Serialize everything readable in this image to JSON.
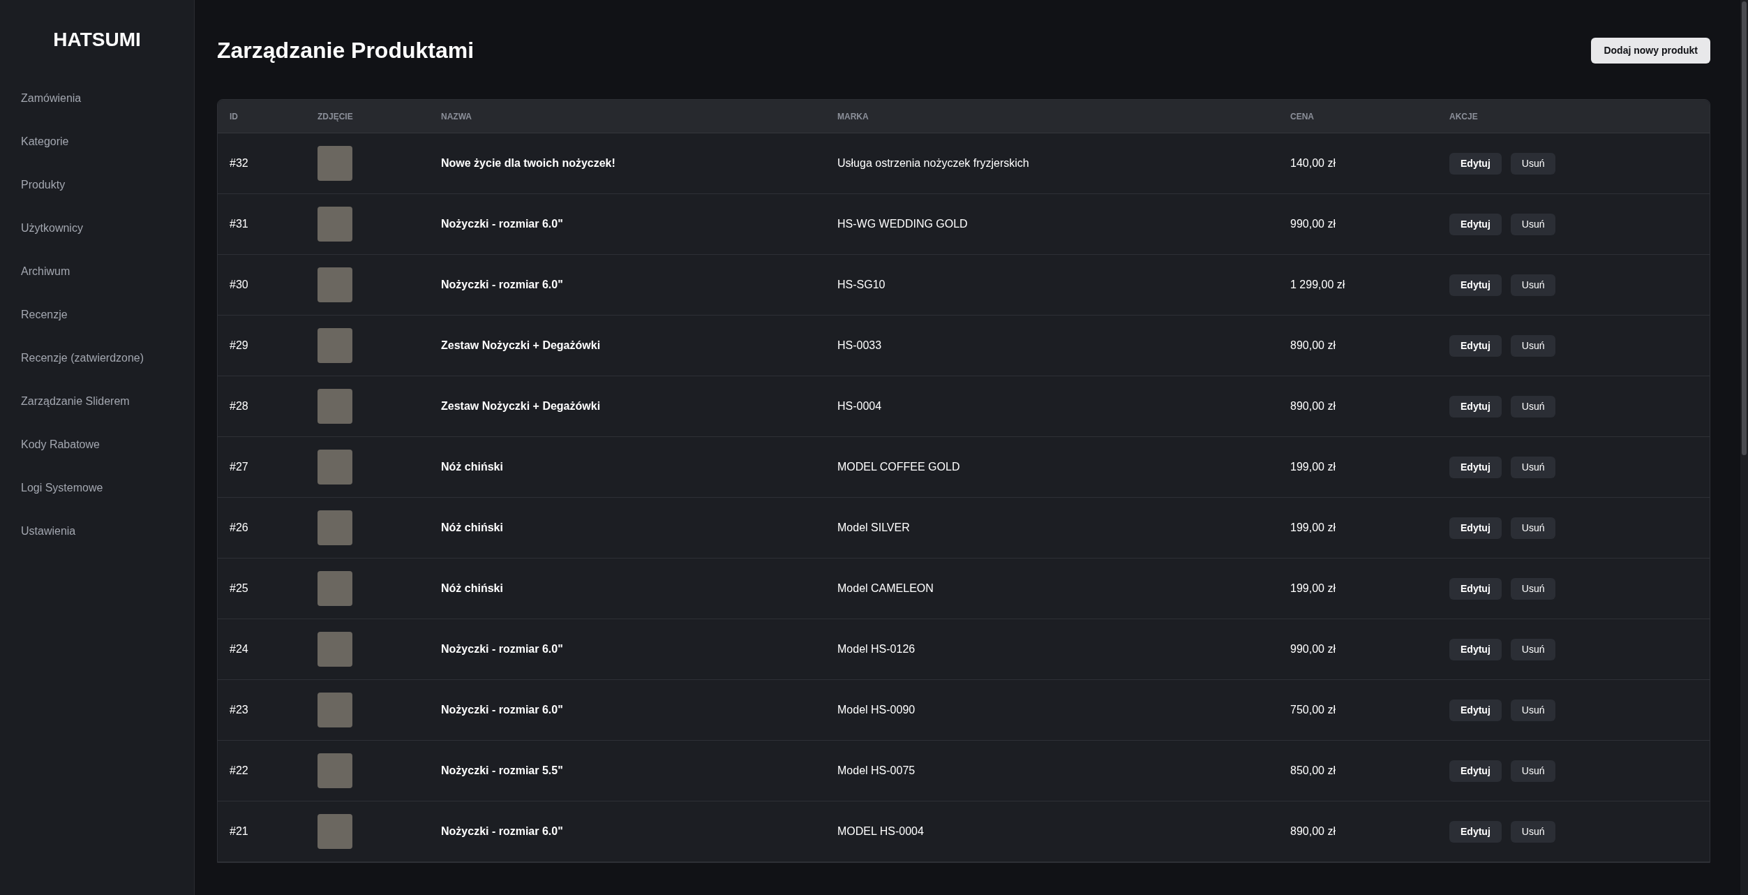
{
  "sidebar": {
    "logo": "HATSUMI",
    "items": [
      {
        "label": "Zamówienia"
      },
      {
        "label": "Kategorie"
      },
      {
        "label": "Produkty"
      },
      {
        "label": "Użytkownicy"
      },
      {
        "label": "Archiwum"
      },
      {
        "label": "Recenzje"
      },
      {
        "label": "Recenzje (zatwierdzone)"
      },
      {
        "label": "Zarządzanie Sliderem"
      },
      {
        "label": "Kody Rabatowe"
      },
      {
        "label": "Logi Systemowe"
      },
      {
        "label": "Ustawienia"
      }
    ]
  },
  "header": {
    "title": "Zarządzanie Produktami",
    "add_button": "Dodaj nowy produkt"
  },
  "table": {
    "columns": [
      "ID",
      "ZDJĘCIE",
      "NAZWA",
      "MARKA",
      "CENA",
      "AKCJE"
    ],
    "rows": [
      {
        "id": "#32",
        "name": "Nowe życie dla twoich nożyczek!",
        "brand": "Usługa ostrzenia nożyczek fryzjerskich",
        "price": "140,00 zł",
        "edit": "Edytuj",
        "delete": "Usuń"
      },
      {
        "id": "#31",
        "name": "Nożyczki - rozmiar 6.0\"",
        "brand": "HS-WG WEDDING GOLD",
        "price": "990,00 zł",
        "edit": "Edytuj",
        "delete": "Usuń"
      },
      {
        "id": "#30",
        "name": "Nożyczki - rozmiar 6.0\"",
        "brand": "HS-SG10",
        "price": "1 299,00 zł",
        "edit": "Edytuj",
        "delete": "Usuń"
      },
      {
        "id": "#29",
        "name": "Zestaw Nożyczki + Degażówki",
        "brand": "HS-0033",
        "price": "890,00 zł",
        "edit": "Edytuj",
        "delete": "Usuń"
      },
      {
        "id": "#28",
        "name": "Zestaw Nożyczki + Degażówki",
        "brand": "HS-0004",
        "price": "890,00 zł",
        "edit": "Edytuj",
        "delete": "Usuń"
      },
      {
        "id": "#27",
        "name": "Nóż chiński",
        "brand": "MODEL COFFEE GOLD",
        "price": "199,00 zł",
        "edit": "Edytuj",
        "delete": "Usuń"
      },
      {
        "id": "#26",
        "name": "Nóż chiński",
        "brand": "Model SILVER",
        "price": "199,00 zł",
        "edit": "Edytuj",
        "delete": "Usuń"
      },
      {
        "id": "#25",
        "name": "Nóż chiński",
        "brand": "Model CAMELEON",
        "price": "199,00 zł",
        "edit": "Edytuj",
        "delete": "Usuń"
      },
      {
        "id": "#24",
        "name": "Nożyczki - rozmiar 6.0\"",
        "brand": "Model HS-0126",
        "price": "990,00 zł",
        "edit": "Edytuj",
        "delete": "Usuń"
      },
      {
        "id": "#23",
        "name": "Nożyczki - rozmiar 6.0\"",
        "brand": "Model HS-0090",
        "price": "750,00 zł",
        "edit": "Edytuj",
        "delete": "Usuń"
      },
      {
        "id": "#22",
        "name": "Nożyczki - rozmiar 5.5\"",
        "brand": "Model HS-0075",
        "price": "850,00 zł",
        "edit": "Edytuj",
        "delete": "Usuń"
      },
      {
        "id": "#21",
        "name": "Nożyczki - rozmiar 6.0\"",
        "brand": "MODEL HS-0004",
        "price": "890,00 zł",
        "edit": "Edytuj",
        "delete": "Usuń"
      }
    ]
  }
}
